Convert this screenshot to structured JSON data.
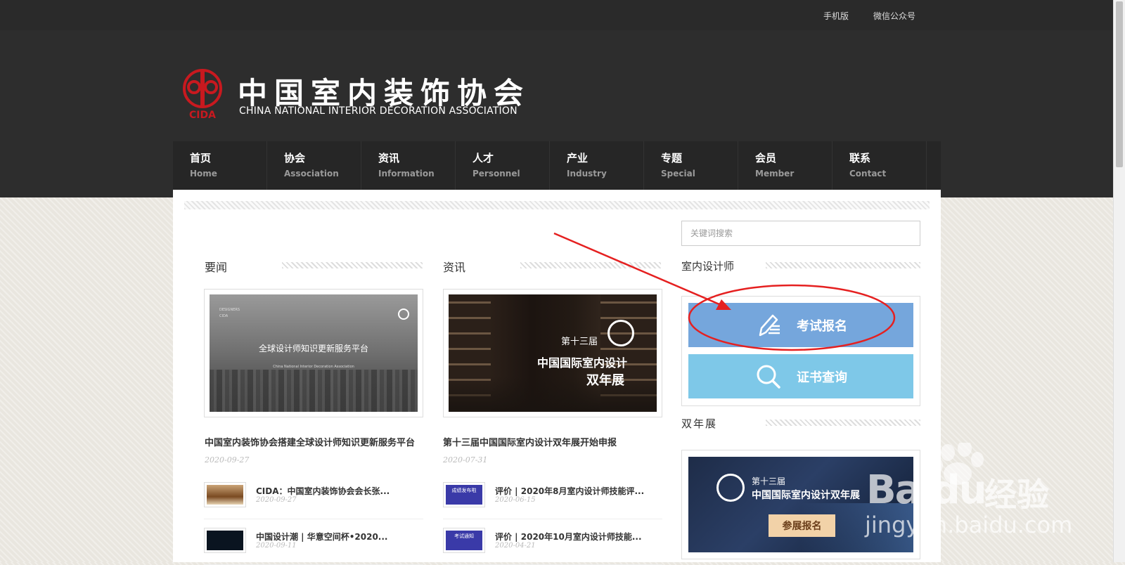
{
  "topbar": {
    "mobile": "手机版",
    "wechat": "微信公众号"
  },
  "logo": {
    "cn": "中国室内装饰协会",
    "en": "CHINA NATIONAL INTERIOR DECORATION ASSOCIATION",
    "badge": "CIDA"
  },
  "nav": [
    {
      "cn": "首页",
      "en": "Home"
    },
    {
      "cn": "协会",
      "en": "Association"
    },
    {
      "cn": "资讯",
      "en": "Information"
    },
    {
      "cn": "人才",
      "en": "Personnel"
    },
    {
      "cn": "产业",
      "en": "Industry"
    },
    {
      "cn": "专题",
      "en": "Special"
    },
    {
      "cn": "会员",
      "en": "Member"
    },
    {
      "cn": "联系",
      "en": "Contact"
    }
  ],
  "search": {
    "placeholder": "关键词搜索"
  },
  "news": {
    "title": "要闻",
    "feature": {
      "image_text": "全球设计师知识更新服务平台",
      "image_sub": "China National Interior Decoration Association",
      "image_tl": "DESIGNERS\nCIDA",
      "headline": "中国室内装饰协会搭建全球设计师知识更新服务平台",
      "date": "2020-09-27"
    },
    "items": [
      {
        "title": "CIDA：中国室内装饰协会会长张...",
        "date": "2020-09-27"
      },
      {
        "title": "中国设计潮 | 华意空间杯•2020...",
        "date": "2020-09-11"
      }
    ]
  },
  "info": {
    "title": "资讯",
    "feature": {
      "image_t1": "第十三届",
      "image_t2": "中国国际室内设计",
      "image_t3": "双年展",
      "headline": "第十三届中国国际室内设计双年展开始申报",
      "date": "2020-07-31"
    },
    "items": [
      {
        "title": "评价 | 2020年8月室内设计师技能评...",
        "date": "2020-06-15",
        "thumb_text": "成绩发布啦"
      },
      {
        "title": "评价 | 2020年10月室内设计师技能...",
        "date": "2020-04-21",
        "thumb_text": "考试通知"
      }
    ]
  },
  "designer": {
    "title": "室内设计师",
    "exam_label": "考试报名",
    "cert_label": "证书查询"
  },
  "expo": {
    "title": "双年展",
    "t1": "第十三届",
    "t2": "中国国际室内设计双年展",
    "button": "参展报名"
  },
  "watermark": {
    "brand": "Bai",
    "brand2": "du",
    "cn": "经验",
    "url": "jingyan.baidu.com"
  },
  "colors": {
    "exam_btn": "#75a6dc",
    "cert_btn": "#7ec8e8",
    "annotation": "#e52020"
  }
}
